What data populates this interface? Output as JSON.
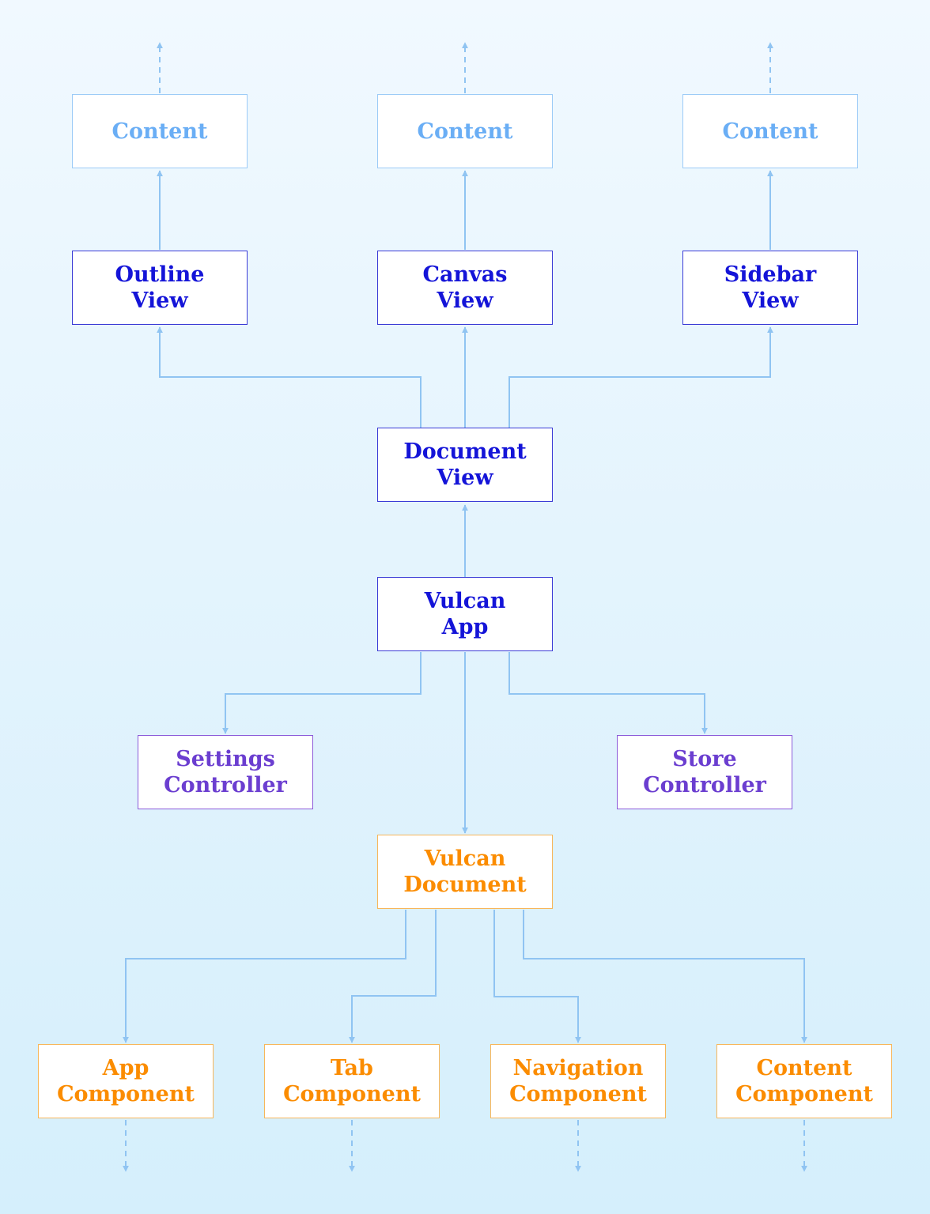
{
  "diagram": {
    "colors": {
      "content": "#6aaef5",
      "view": "#1414d8",
      "controller": "#6b3ed0",
      "model": "#fb8c00",
      "edge": "#90c4f2"
    },
    "nodes": {
      "content_1": {
        "lines": [
          "Content"
        ],
        "kind": "content"
      },
      "content_2": {
        "lines": [
          "Content"
        ],
        "kind": "content"
      },
      "content_3": {
        "lines": [
          "Content"
        ],
        "kind": "content"
      },
      "outline_view": {
        "lines": [
          "Outline",
          "View"
        ],
        "kind": "view"
      },
      "canvas_view": {
        "lines": [
          "Canvas",
          "View"
        ],
        "kind": "view"
      },
      "sidebar_view": {
        "lines": [
          "Sidebar",
          "View"
        ],
        "kind": "view"
      },
      "document_view": {
        "lines": [
          "Document",
          "View"
        ],
        "kind": "view"
      },
      "vulcan_app": {
        "lines": [
          "Vulcan",
          "App"
        ],
        "kind": "view"
      },
      "settings_controller": {
        "lines": [
          "Settings",
          "Controller"
        ],
        "kind": "controller"
      },
      "store_controller": {
        "lines": [
          "Store",
          "Controller"
        ],
        "kind": "controller"
      },
      "vulcan_document": {
        "lines": [
          "Vulcan",
          "Document"
        ],
        "kind": "model"
      },
      "app_component": {
        "lines": [
          "App",
          "Component"
        ],
        "kind": "model"
      },
      "tab_component": {
        "lines": [
          "Tab",
          "Component"
        ],
        "kind": "model"
      },
      "navigation_component": {
        "lines": [
          "Navigation",
          "Component"
        ],
        "kind": "model"
      },
      "content_component": {
        "lines": [
          "Content",
          "Component"
        ],
        "kind": "model"
      }
    },
    "edges": [
      {
        "from": "document_view",
        "to": "outline_view",
        "style": "solid"
      },
      {
        "from": "document_view",
        "to": "canvas_view",
        "style": "solid"
      },
      {
        "from": "document_view",
        "to": "sidebar_view",
        "style": "solid"
      },
      {
        "from": "outline_view",
        "to": "content_1",
        "style": "solid"
      },
      {
        "from": "canvas_view",
        "to": "content_2",
        "style": "solid"
      },
      {
        "from": "sidebar_view",
        "to": "content_3",
        "style": "solid"
      },
      {
        "from": "content_1",
        "to": "(continues)",
        "style": "dashed"
      },
      {
        "from": "content_2",
        "to": "(continues)",
        "style": "dashed"
      },
      {
        "from": "content_3",
        "to": "(continues)",
        "style": "dashed"
      },
      {
        "from": "vulcan_app",
        "to": "document_view",
        "style": "solid"
      },
      {
        "from": "vulcan_app",
        "to": "settings_controller",
        "style": "solid"
      },
      {
        "from": "vulcan_app",
        "to": "store_controller",
        "style": "solid"
      },
      {
        "from": "vulcan_app",
        "to": "vulcan_document",
        "style": "solid"
      },
      {
        "from": "vulcan_document",
        "to": "app_component",
        "style": "solid"
      },
      {
        "from": "vulcan_document",
        "to": "tab_component",
        "style": "solid"
      },
      {
        "from": "vulcan_document",
        "to": "navigation_component",
        "style": "solid"
      },
      {
        "from": "vulcan_document",
        "to": "content_component",
        "style": "solid"
      },
      {
        "from": "app_component",
        "to": "(continues)",
        "style": "dashed"
      },
      {
        "from": "tab_component",
        "to": "(continues)",
        "style": "dashed"
      },
      {
        "from": "navigation_component",
        "to": "(continues)",
        "style": "dashed"
      },
      {
        "from": "content_component",
        "to": "(continues)",
        "style": "dashed"
      }
    ]
  }
}
